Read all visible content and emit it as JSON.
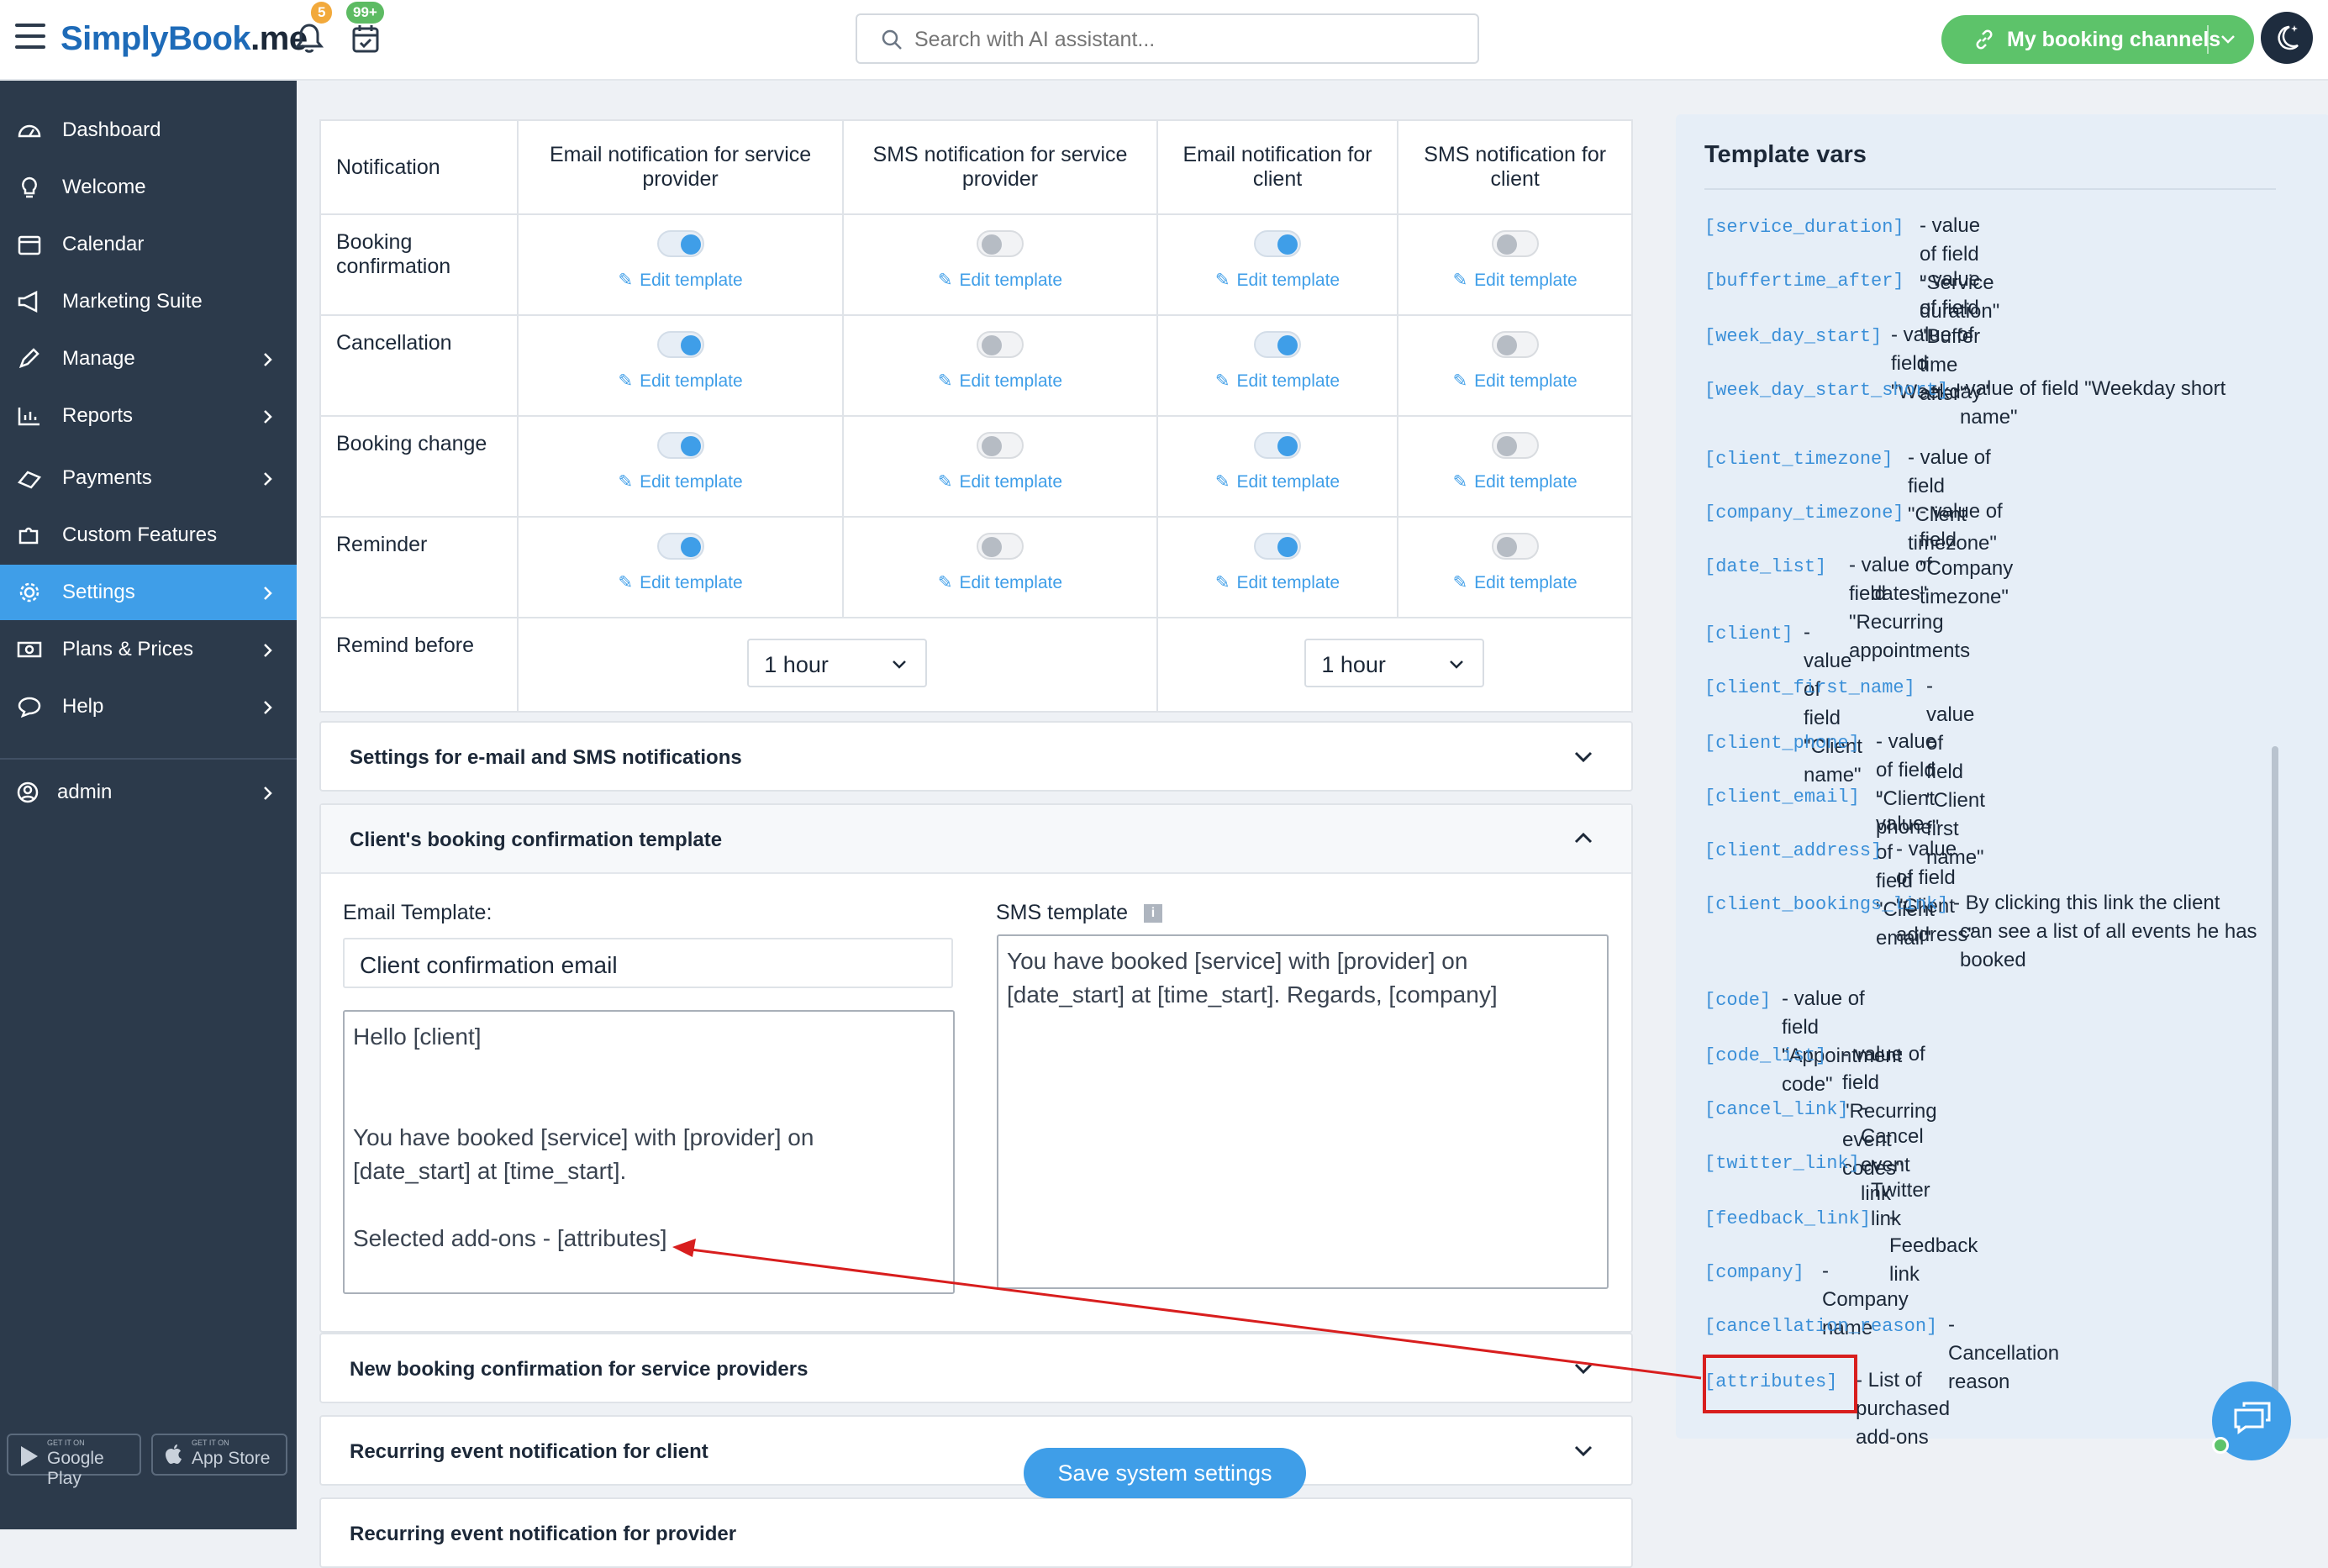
{
  "header": {
    "logo_main": "SimplyBook",
    "logo_suffix": ".me",
    "notifications_badge": "5",
    "tasks_badge": "99+",
    "search_placeholder": "Search with AI assistant...",
    "channels_button": "My booking channels"
  },
  "sidebar": {
    "items": [
      {
        "label": "Dashboard",
        "icon": "dashboard-icon"
      },
      {
        "label": "Welcome",
        "icon": "lightbulb-icon"
      },
      {
        "label": "Calendar",
        "icon": "calendar-icon"
      },
      {
        "label": "Marketing Suite",
        "icon": "megaphone-icon"
      },
      {
        "label": "Manage",
        "icon": "pencil-icon"
      },
      {
        "label": "Reports",
        "icon": "chart-icon"
      },
      {
        "label": "Payments",
        "icon": "card-icon"
      },
      {
        "label": "Custom Features",
        "icon": "puzzle-icon"
      },
      {
        "label": "Settings",
        "icon": "gear-icon"
      },
      {
        "label": "Plans & Prices",
        "icon": "money-icon"
      },
      {
        "label": "Help",
        "icon": "chat-icon"
      }
    ],
    "user": "admin",
    "google_small": "GET IT ON",
    "google": "Google Play",
    "apple_small": "GET IT ON",
    "apple": "App Store"
  },
  "table": {
    "headers": [
      "Notification",
      "Email notification for service provider",
      "SMS notification for service provider",
      "Email notification for client",
      "SMS notification for client"
    ],
    "rows": [
      {
        "label": "Booking confirmation",
        "toggles": [
          true,
          false,
          true,
          false
        ]
      },
      {
        "label": "Cancellation",
        "toggles": [
          true,
          false,
          true,
          false
        ]
      },
      {
        "label": "Booking change",
        "toggles": [
          true,
          false,
          true,
          false
        ]
      },
      {
        "label": "Reminder",
        "toggles": [
          true,
          false,
          true,
          false
        ]
      }
    ],
    "edit_label": "Edit template",
    "remind_label": "Remind before",
    "remind_provider": "1 hour",
    "remind_client": "1 hour"
  },
  "panels": {
    "settings": "Settings for e-mail and SMS notifications",
    "client_confirm": "Client's booking confirmation template",
    "new_booking": "New booking confirmation for service providers",
    "recurring_client": "Recurring event notification for client",
    "recurring_provider": "Recurring event notification for provider"
  },
  "template": {
    "email_label": "Email Template:",
    "email_subject": "Client confirmation email",
    "email_lines": [
      "Hello [client]",
      "",
      "",
      "You have booked [service] with [provider] on",
      "[date_start] at [time_start].",
      "",
      "Selected add-ons - [attributes]"
    ],
    "sms_label": "SMS template",
    "sms_lines": [
      "You have booked [service] with [provider] on",
      "[date_start] at [time_start]. Regards, [company]"
    ]
  },
  "save_button": "Save system settings",
  "vars": {
    "title": "Template vars",
    "items": [
      {
        "code": "[service_duration]",
        "desc": "- value of field \"Service duration\""
      },
      {
        "code": "[buffertime_after]",
        "desc": "- value of field \"Buffer time after\""
      },
      {
        "code": "[week_day_start]",
        "desc": "- value of field \"Weekday\""
      },
      {
        "code": "[week_day_start_short]",
        "desc": "- value of field \"Weekday short",
        "desc2": "name\""
      },
      {
        "code": "[client_timezone]",
        "desc": "- value of field \"Client timezone\""
      },
      {
        "code": "[company_timezone]",
        "desc": "- value of field \"Company timezone\""
      },
      {
        "code": "[date_list]",
        "desc": "- value of field \"Recurring appointments",
        "desc2": "dates\""
      },
      {
        "code": "[client]",
        "desc": "- value of field \"Client name\""
      },
      {
        "code": "[client_first_name]",
        "desc": "- value of field \"Client first name\""
      },
      {
        "code": "[client_phone]",
        "desc": "- value of field \"Client phone\""
      },
      {
        "code": "[client_email]",
        "desc": "- value of field \"Client email\""
      },
      {
        "code": "[client_address]",
        "desc": "- value of field \"Client address\""
      },
      {
        "code": "[client_bookings_link]",
        "desc": "- By clicking this link the client",
        "desc2": "can see a list of all events he has",
        "desc3": "booked"
      },
      {
        "code": "[code]",
        "desc": "- value of field \"Appointment code\""
      },
      {
        "code": "[code_list]",
        "desc": "- value of field \"Recurring event codes\""
      },
      {
        "code": "[cancel_link]",
        "desc": "- Cancel event link"
      },
      {
        "code": "[twitter_link]",
        "desc": "- Twitter link"
      },
      {
        "code": "[feedback_link]",
        "desc": "- Feedback link"
      },
      {
        "code": "[company]",
        "desc": "- Company name"
      },
      {
        "code": "[cancellation_reason]",
        "desc": "- Cancellation reason"
      },
      {
        "code": "[attributes]",
        "desc": "- List of purchased add-ons"
      }
    ]
  },
  "colors": {
    "accent": "#3f9ee8",
    "sidebar": "#2c3a4b",
    "green": "#5dc36a",
    "annotation": "#d81e1e"
  }
}
